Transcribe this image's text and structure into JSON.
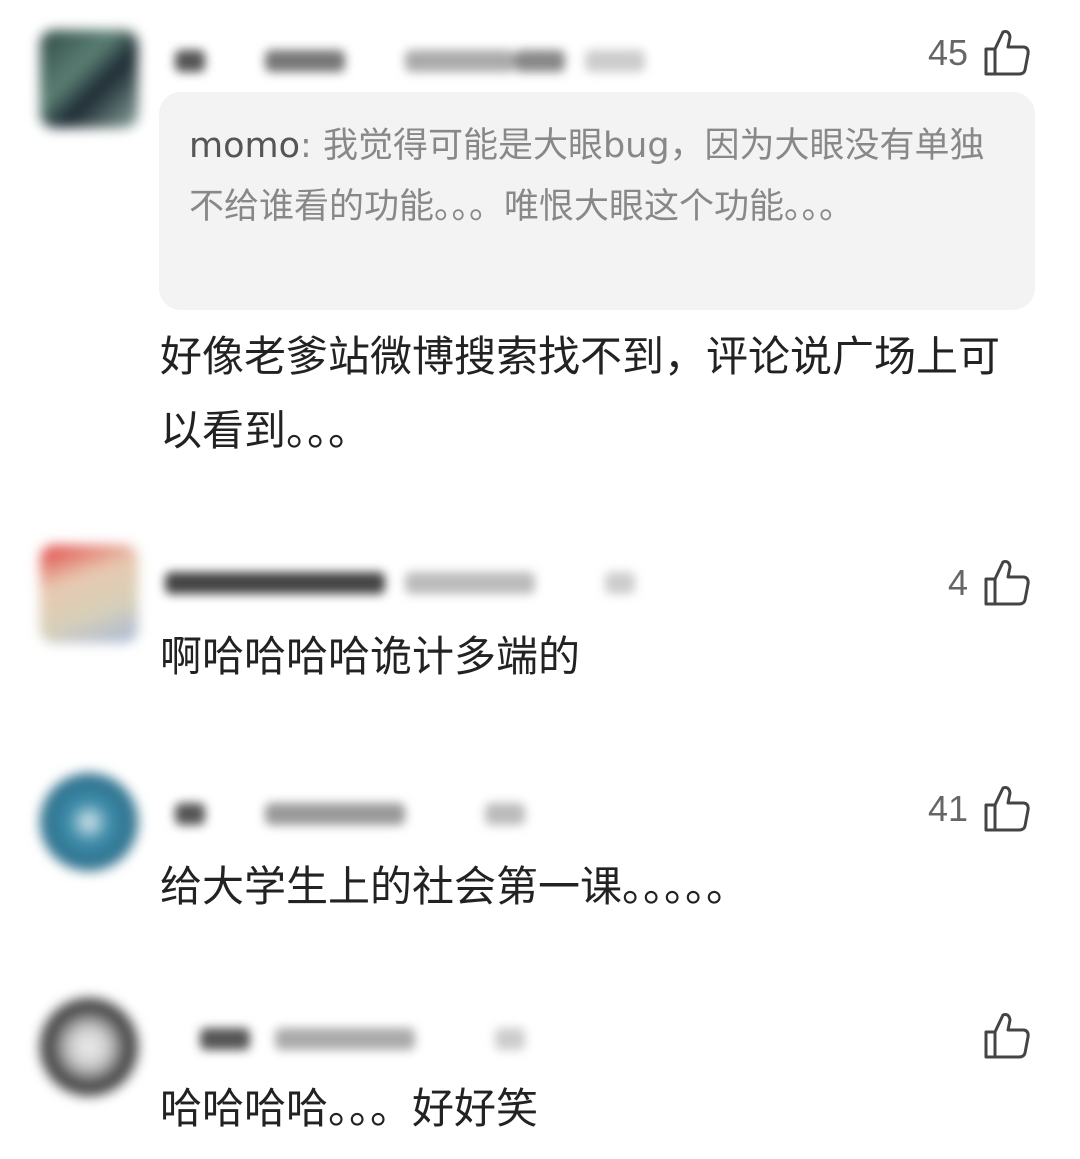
{
  "comments": [
    {
      "like_count": "45",
      "quote_user": "momo",
      "quote_sep": ": ",
      "quote_text": "我觉得可能是大眼bug，因为大眼没有单独不给谁看的功能。。。唯恨大眼这个功能。。。",
      "text": "好像老爹站微博搜索找不到，评论说广场上可以看到。。。"
    },
    {
      "like_count": "4",
      "text": "啊哈哈哈哈诡计多端的"
    },
    {
      "like_count": "41",
      "text": "给大学生上的社会第一课。。。。。"
    },
    {
      "like_count": "",
      "text": "哈哈哈哈。。。好好笑"
    }
  ],
  "icons": {
    "like": "thumbs-up-icon"
  },
  "colors": {
    "quote_bg": "#f3f3f3",
    "like_count": "#666666",
    "text": "#222222"
  }
}
